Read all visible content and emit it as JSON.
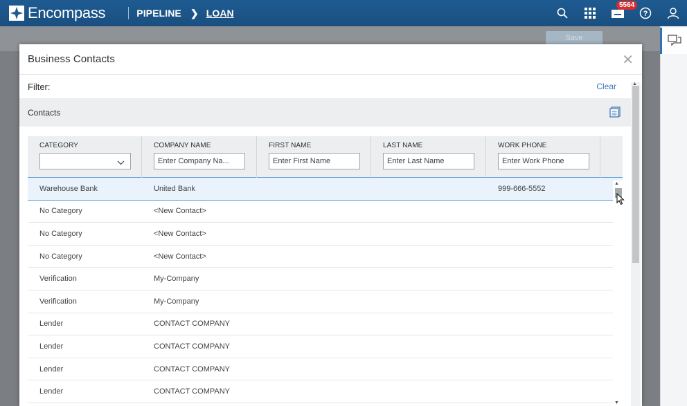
{
  "app": {
    "logo_text": "Encompass",
    "breadcrumb": [
      "PIPELINE",
      "LOAN"
    ],
    "notification_count": "5564"
  },
  "background": {
    "save_label": "Save"
  },
  "modal": {
    "title": "Business Contacts",
    "filter_label": "Filter:",
    "clear_label": "Clear",
    "contacts_label": "Contacts",
    "columns": [
      {
        "label": "CATEGORY",
        "placeholder": ""
      },
      {
        "label": "COMPANY NAME",
        "placeholder": "Enter Company Na..."
      },
      {
        "label": "FIRST NAME",
        "placeholder": "Enter First Name"
      },
      {
        "label": "LAST NAME",
        "placeholder": "Enter Last Name"
      },
      {
        "label": "WORK PHONE",
        "placeholder": "Enter Work Phone"
      }
    ],
    "rows": [
      {
        "category": "Warehouse Bank",
        "company": "United Bank",
        "first": "",
        "last": "",
        "phone": "999-666-5552"
      },
      {
        "category": "No Category",
        "company": "<New Contact>",
        "first": "",
        "last": "",
        "phone": ""
      },
      {
        "category": "No Category",
        "company": "<New Contact>",
        "first": "",
        "last": "",
        "phone": ""
      },
      {
        "category": "No Category",
        "company": "<New Contact>",
        "first": "",
        "last": "",
        "phone": ""
      },
      {
        "category": "Verification",
        "company": "My-Company",
        "first": "",
        "last": "",
        "phone": ""
      },
      {
        "category": "Verification",
        "company": "My-Company",
        "first": "",
        "last": "",
        "phone": ""
      },
      {
        "category": "Lender",
        "company": "CONTACT COMPANY",
        "first": "",
        "last": "",
        "phone": ""
      },
      {
        "category": "Lender",
        "company": "CONTACT COMPANY",
        "first": "",
        "last": "",
        "phone": ""
      },
      {
        "category": "Lender",
        "company": "CONTACT COMPANY",
        "first": "",
        "last": "",
        "phone": ""
      },
      {
        "category": "Lender",
        "company": "CONTACT COMPANY",
        "first": "",
        "last": "",
        "phone": ""
      }
    ],
    "selected_row": 0
  },
  "icons": {
    "logo": "encompass-logo-icon",
    "search": "search-icon",
    "apps": "apps-grid-icon",
    "inbox": "inbox-icon",
    "help": "help-icon",
    "user": "user-icon",
    "chat": "chat-icon",
    "close": "close-icon",
    "export": "document-icon",
    "dropdown": "chevron-down-icon"
  },
  "colors": {
    "topbar": "#1e5b91",
    "link": "#3a78b5",
    "badge": "#d72d2d",
    "selected_row": "#eaf3fb"
  }
}
